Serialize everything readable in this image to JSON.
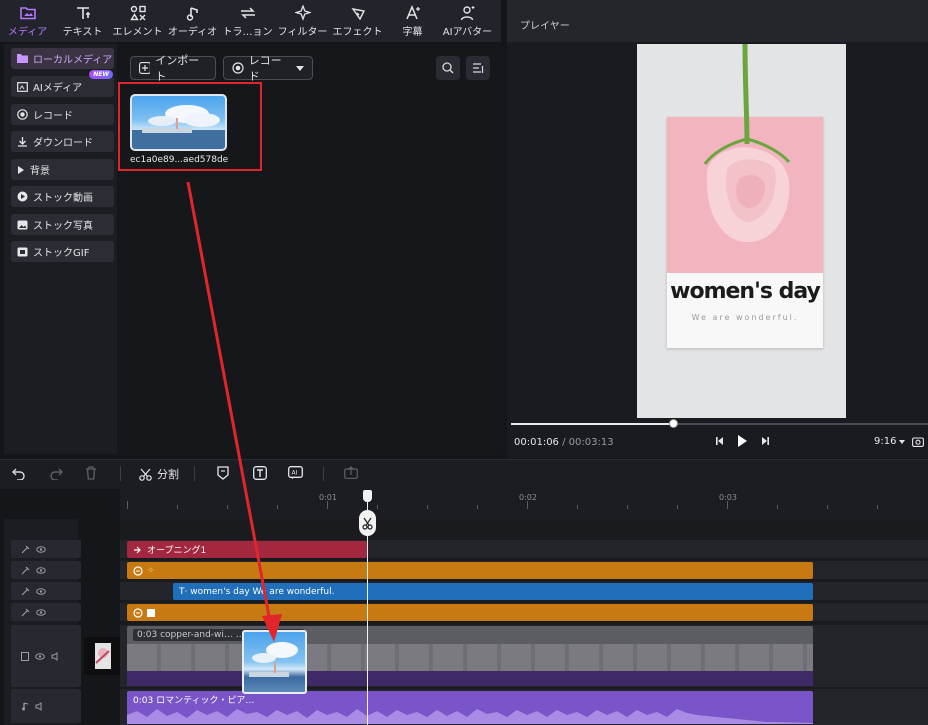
{
  "toolbar": {
    "tabs": [
      {
        "label": "メディア",
        "icon": "media-icon"
      },
      {
        "label": "テキスト",
        "icon": "text-icon"
      },
      {
        "label": "エレメント",
        "icon": "elements-icon"
      },
      {
        "label": "オーディオ",
        "icon": "audio-icon"
      },
      {
        "label": "トラ…ョン",
        "icon": "transition-icon"
      },
      {
        "label": "フィルター",
        "icon": "filter-icon"
      },
      {
        "label": "エフェクト",
        "icon": "effect-icon"
      },
      {
        "label": "字幕",
        "icon": "subtitle-icon"
      },
      {
        "label": "AIアバター",
        "icon": "ai-avatar-icon"
      }
    ],
    "active_color": "#b577ff"
  },
  "sidebar": {
    "items": [
      {
        "label": "ローカルメディア",
        "icon": "folder-icon"
      },
      {
        "label": "AIメディア",
        "icon": "ai-media-icon",
        "badge": "NEW"
      },
      {
        "label": "レコード",
        "icon": "record-icon"
      },
      {
        "label": "ダウンロード",
        "icon": "download-icon"
      },
      {
        "label": "背景",
        "icon": "background-icon"
      },
      {
        "label": "ストック動画",
        "icon": "stock-video-icon"
      },
      {
        "label": "ストック写真",
        "icon": "stock-photo-icon"
      },
      {
        "label": "ストックGIF",
        "icon": "stock-gif-icon"
      }
    ]
  },
  "media": {
    "import_label": "インポート",
    "record_label": "レコード",
    "file_name": "ec1a0e89...aed578de"
  },
  "player": {
    "title": "プレイヤー",
    "poster_title": "women's day",
    "poster_subtitle": "We are wonderful.",
    "current_time": "00:01:06",
    "total_time": "/ 00:03:13",
    "aspect": "9:16",
    "progress": 0.39
  },
  "timeline": {
    "split_label": "分割",
    "ruler": [
      "0:01",
      "0:02",
      "0:03"
    ],
    "clips": {
      "opening": "オープニング1",
      "text": "T· women's day We are wonderful.",
      "video": "0:03 copper-and-wi…    …Kg-unsplash",
      "audio": "0:03 ロマンティック・ピア…"
    }
  },
  "colors": {
    "accent": "#b577ff",
    "highlight_red": "#e0262a",
    "opening_clip": "#a3283f",
    "effect_clip": "#c77a12",
    "text_clip": "#1f6fba",
    "audio_clip": "#7a55c9"
  }
}
